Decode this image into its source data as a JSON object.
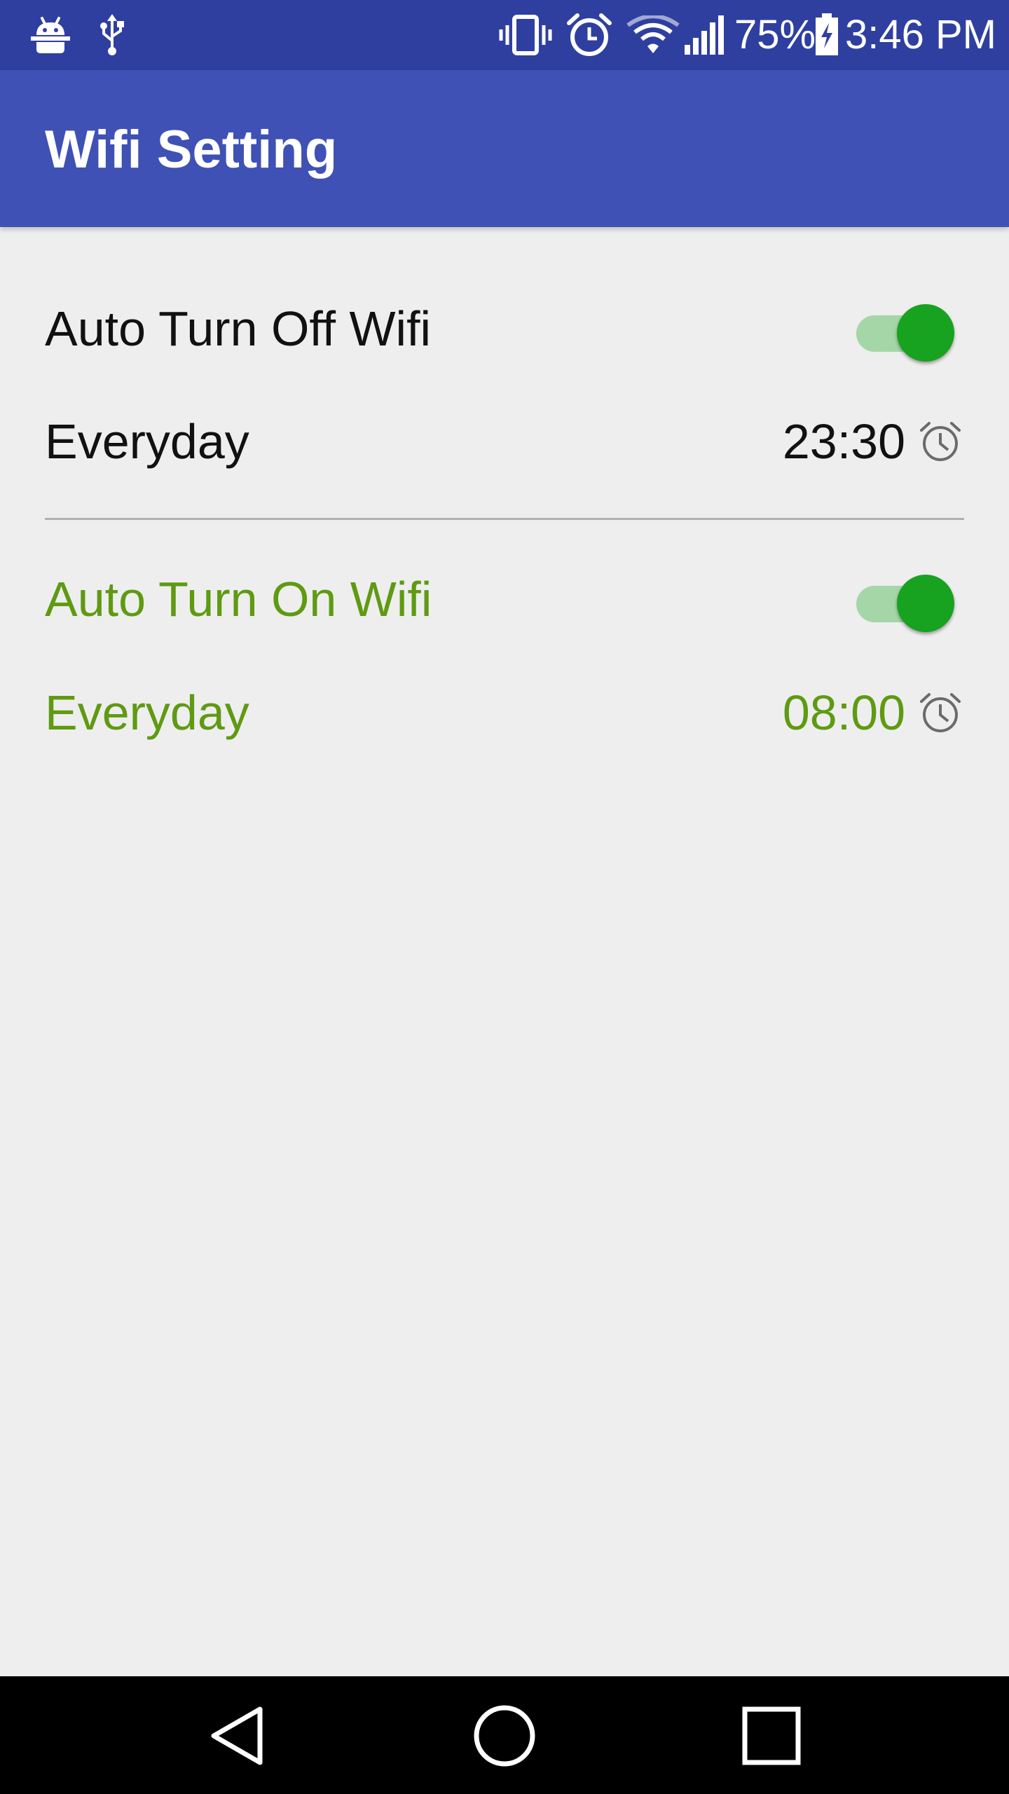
{
  "status_bar": {
    "left_icons": [
      "android-debug-icon",
      "usb-icon"
    ],
    "right_icons": [
      "vibrate-icon",
      "alarm-icon",
      "wifi-icon",
      "cell-signal-icon",
      "battery-charging-icon"
    ],
    "battery_percent": "75%",
    "time": "3:46 PM",
    "background_color": "#2f3fa0"
  },
  "app_bar": {
    "title": "Wifi Setting",
    "background_color": "#3f51b5"
  },
  "off_section": {
    "label": "Auto Turn Off Wifi",
    "enabled": true,
    "schedule_label": "Everyday",
    "time": "23:30",
    "text_color": "#111111"
  },
  "on_section": {
    "label": "Auto Turn On Wifi",
    "enabled": true,
    "schedule_label": "Everyday",
    "time": "08:00",
    "text_color": "#5f9a12"
  },
  "toggle_colors": {
    "thumb": "#17a21f",
    "track": "#a5d6a7"
  },
  "nav_bar": {
    "buttons": [
      "back-icon",
      "home-icon",
      "recents-icon"
    ]
  }
}
